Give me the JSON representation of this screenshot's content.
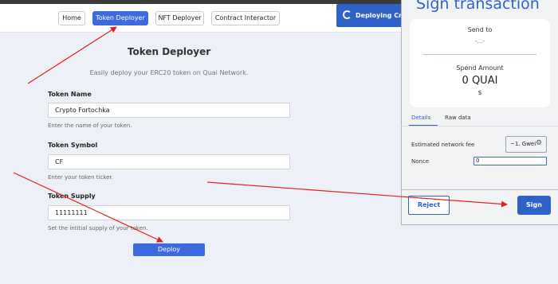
{
  "nav": {
    "items": [
      {
        "label": "Home"
      },
      {
        "label": "Token Deployer"
      },
      {
        "label": "NFT Deployer"
      },
      {
        "label": "Contract Interactor"
      }
    ],
    "status_button": "Deploying Cry"
  },
  "deployer": {
    "title": "Token Deployer",
    "subtitle": "Easily deploy your ERC20 token on Quai Network.",
    "fields": [
      {
        "label": "Token Name",
        "value": "Crypto Fortochka",
        "hint": "Enter the name of your token."
      },
      {
        "label": "Token Symbol",
        "value": "CF",
        "hint": "Enter your token ticker."
      },
      {
        "label": "Token Supply",
        "value": "11111111",
        "hint": "Set the intitial supply of your token."
      }
    ],
    "deploy_label": "Deploy"
  },
  "popup": {
    "title": "Sign transaction",
    "send_to_label": "Send to",
    "send_to_value": "-...-",
    "spend_label": "Spend Amount",
    "spend_value": "0 QUAI",
    "spend_fiat": "$",
    "tabs": [
      "Details",
      "Raw data"
    ],
    "fee_label": "Estimated network fee",
    "fee_value": "~1. Gwei",
    "nonce_label": "Nonce",
    "nonce_value": "0",
    "reject_label": "Reject",
    "sign_label": "Sign"
  },
  "colors": {
    "accent": "#3d6adf",
    "popup_accent": "#2f62c9",
    "annotation_arrow": "#e02020",
    "page_background": "#eef0f7"
  }
}
